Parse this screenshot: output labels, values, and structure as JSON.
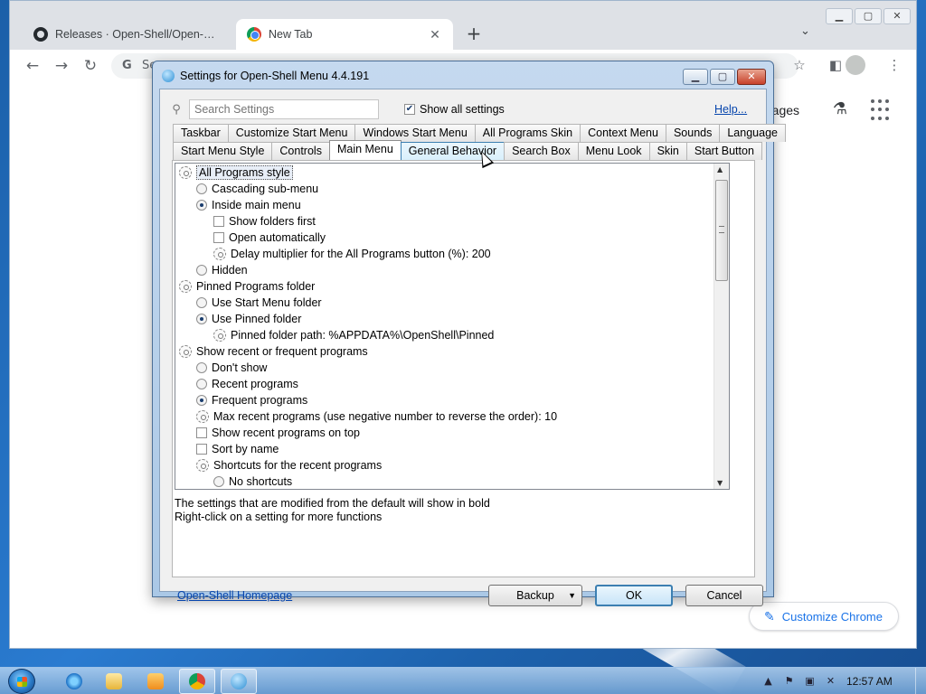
{
  "browser": {
    "tabs": [
      {
        "title": "Releases · Open-Shell/Open-Shel",
        "favicon": "github-icon"
      },
      {
        "title": "New Tab",
        "favicon": "chrome-icon"
      }
    ],
    "new_tab_label": "+",
    "omnibox_text": "Se",
    "ntp_images_label": "mages",
    "customize_label": "Customize Chrome"
  },
  "dialog": {
    "title": "Settings for Open-Shell Menu 4.4.191",
    "search_placeholder": "Search Settings",
    "show_all_label": "Show all settings",
    "show_all_checked": true,
    "help_label": "Help...",
    "tabs_row1": [
      "Taskbar",
      "Customize Start Menu",
      "Windows Start Menu",
      "All Programs Skin",
      "Context Menu",
      "Sounds",
      "Language"
    ],
    "tabs_row2": [
      "Start Menu Style",
      "Controls",
      "Main Menu",
      "General Behavior",
      "Search Box",
      "Menu Look",
      "Skin",
      "Start Button"
    ],
    "active_tab": "Main Menu",
    "hover_tab": "General Behavior",
    "tree_items": [
      {
        "label": "All Programs style",
        "type": "group",
        "level": 0,
        "selected": true
      },
      {
        "label": "Cascading sub-menu",
        "type": "radio",
        "level": 1,
        "checked": false
      },
      {
        "label": "Inside main menu",
        "type": "radio",
        "level": 1,
        "checked": true
      },
      {
        "label": "Show folders first",
        "type": "checkbox",
        "level": 2,
        "checked": false
      },
      {
        "label": "Open automatically",
        "type": "checkbox",
        "level": 2,
        "checked": false
      },
      {
        "label": "Delay multiplier for the All Programs button (%): 200",
        "type": "setting",
        "level": 2
      },
      {
        "label": "Hidden",
        "type": "radio",
        "level": 1,
        "checked": false
      },
      {
        "label": "Pinned Programs folder",
        "type": "group",
        "level": 0
      },
      {
        "label": "Use Start Menu folder",
        "type": "radio",
        "level": 1,
        "checked": false
      },
      {
        "label": "Use Pinned folder",
        "type": "radio",
        "level": 1,
        "checked": true
      },
      {
        "label": "Pinned folder path: %APPDATA%\\OpenShell\\Pinned",
        "type": "setting",
        "level": 2
      },
      {
        "label": "Show recent or frequent programs",
        "type": "group",
        "level": 0
      },
      {
        "label": "Don't show",
        "type": "radio",
        "level": 1,
        "checked": false
      },
      {
        "label": "Recent programs",
        "type": "radio",
        "level": 1,
        "checked": false
      },
      {
        "label": "Frequent programs",
        "type": "radio",
        "level": 1,
        "checked": true
      },
      {
        "label": "Max recent programs (use negative number to reverse the order): 10",
        "type": "setting",
        "level": 1
      },
      {
        "label": "Show recent programs on top",
        "type": "checkbox",
        "level": 1,
        "checked": false
      },
      {
        "label": "Sort by name",
        "type": "checkbox",
        "level": 1,
        "checked": false
      },
      {
        "label": "Shortcuts for the recent programs",
        "type": "setting",
        "level": 1
      },
      {
        "label": "No shortcuts",
        "type": "radio",
        "level": 2,
        "checked": false
      }
    ],
    "note_line1": "The settings that are modified from the default will show in bold",
    "note_line2": "Right-click on a setting for more functions",
    "homepage_label": "Open-Shell Homepage",
    "backup_label": "Backup",
    "ok_label": "OK",
    "cancel_label": "Cancel"
  },
  "taskbar": {
    "clock": "12:57 AM",
    "pinned": [
      "internet-explorer-icon",
      "folder-icon",
      "media-player-icon",
      "chrome-icon",
      "open-shell-icon"
    ]
  }
}
